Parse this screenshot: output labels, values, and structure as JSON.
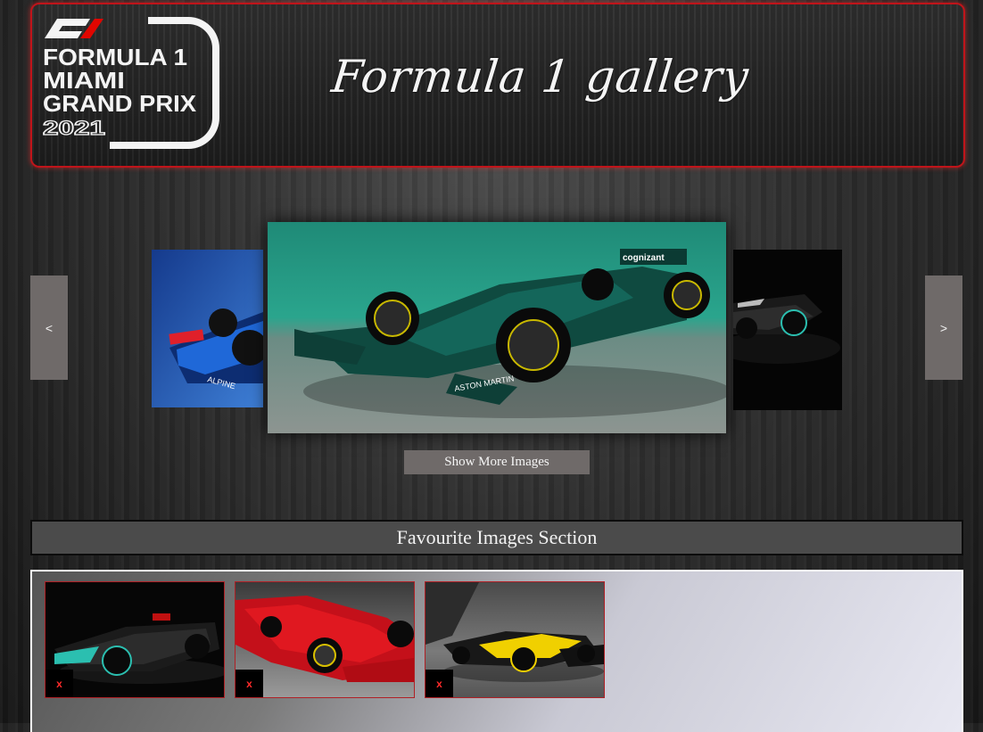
{
  "header": {
    "logo": {
      "brand": "F1",
      "line1": "FORMULA 1",
      "line2": "MIAMI",
      "line3": "GRAND PRIX",
      "year": "2021"
    },
    "title": "Formula 1 gallery"
  },
  "carousel": {
    "prev_label": "<",
    "next_label": ">",
    "slides": [
      {
        "icon": "alpine-car-image"
      },
      {
        "icon": "aston-martin-car-image",
        "sponsor": "cognizant",
        "wing_text": "ASTON MARTIN"
      },
      {
        "icon": "mercedes-car-image"
      }
    ],
    "show_more_label": "Show More Images"
  },
  "favourites": {
    "title": "Favourite Images Section",
    "items": [
      {
        "icon": "mercedes-car-image",
        "remove_label": "x"
      },
      {
        "icon": "ferrari-car-image",
        "remove_label": "x"
      },
      {
        "icon": "renault-car-image",
        "remove_label": "x"
      }
    ]
  },
  "colors": {
    "accent_red": "#c0141a",
    "button_gray": "#6f6a69"
  }
}
